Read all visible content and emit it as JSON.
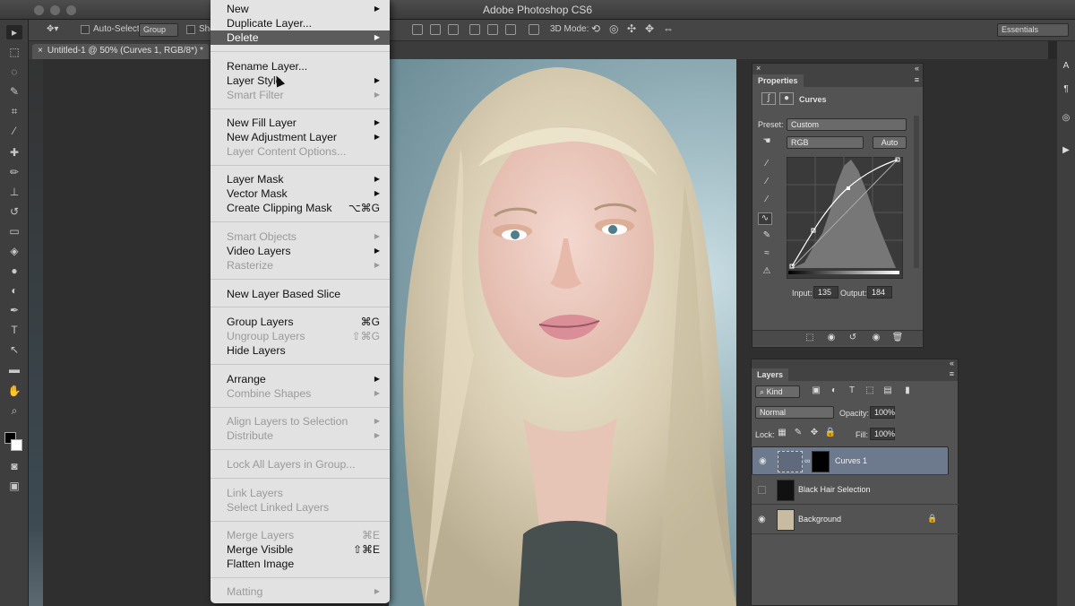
{
  "window": {
    "title": "Adobe Photoshop CS6"
  },
  "options_bar": {
    "auto_select_label": "Auto-Select:",
    "auto_select_value": "Group",
    "show_label": "Sho",
    "mode_3d_label": "3D Mode:",
    "workspace": "Essentials"
  },
  "document": {
    "tab_label": "Untitled-1 @ 50% (Curves 1, RGB/8*) *"
  },
  "menu": {
    "items": [
      {
        "label": "New",
        "submenu": "▶",
        "disabled": false
      },
      {
        "label": "Duplicate Layer...",
        "disabled": false
      },
      {
        "label": "Delete",
        "submenu": "▶",
        "highlighted": true
      },
      {
        "label": "Rename Layer...",
        "disabled": false
      },
      {
        "label": "Layer Style",
        "submenu": "▶"
      },
      {
        "label": "Smart Filter",
        "submenu": "▶",
        "disabled": true
      },
      {
        "label": "New Fill Layer",
        "submenu": "▶"
      },
      {
        "label": "New Adjustment Layer",
        "submenu": "▶"
      },
      {
        "label": "Layer Content Options...",
        "disabled": true
      },
      {
        "label": "Layer Mask",
        "submenu": "▶"
      },
      {
        "label": "Vector Mask",
        "submenu": "▶"
      },
      {
        "label": "Create Clipping Mask",
        "shortcut": "⌥⌘G"
      },
      {
        "label": "Smart Objects",
        "submenu": "▶",
        "disabled": true
      },
      {
        "label": "Video Layers",
        "submenu": "▶"
      },
      {
        "label": "Rasterize",
        "submenu": "▶",
        "disabled": true
      },
      {
        "label": "New Layer Based Slice"
      },
      {
        "label": "Group Layers",
        "shortcut": "⌘G"
      },
      {
        "label": "Ungroup Layers",
        "shortcut": "⇧⌘G",
        "disabled": true
      },
      {
        "label": "Hide Layers"
      },
      {
        "label": "Arrange",
        "submenu": "▶"
      },
      {
        "label": "Combine Shapes",
        "submenu": "▶",
        "disabled": true
      },
      {
        "label": "Align Layers to Selection",
        "submenu": "▶",
        "disabled": true
      },
      {
        "label": "Distribute",
        "submenu": "▶",
        "disabled": true
      },
      {
        "label": "Lock All Layers in Group...",
        "disabled": true
      },
      {
        "label": "Link Layers",
        "disabled": true
      },
      {
        "label": "Select Linked Layers",
        "disabled": true
      },
      {
        "label": "Merge Layers",
        "shortcut": "⌘E",
        "disabled": true
      },
      {
        "label": "Merge Visible",
        "shortcut": "⇧⌘E"
      },
      {
        "label": "Flatten Image"
      },
      {
        "label": "Matting",
        "submenu": "▶",
        "disabled": true
      }
    ]
  },
  "properties": {
    "tab": "Properties",
    "title": "Curves",
    "preset_label": "Preset:",
    "preset_value": "Custom",
    "channel": "RGB",
    "auto_button": "Auto",
    "input_label": "Input:",
    "input_value": "135",
    "output_label": "Output:",
    "output_value": "184"
  },
  "layers": {
    "tab": "Layers",
    "kind_label": "Kind",
    "blend_mode": "Normal",
    "opacity_label": "Opacity:",
    "opacity_value": "100%",
    "lock_label": "Lock:",
    "fill_label": "Fill:",
    "fill_value": "100%",
    "rows": [
      {
        "name": "Curves 1",
        "visible": true,
        "selected": true
      },
      {
        "name": "Black Hair Selection",
        "visible": false
      },
      {
        "name": "Background",
        "visible": true,
        "locked": true
      }
    ]
  },
  "colors": {
    "accent": "#6d7a8d",
    "menu_highlight": "#5b5b5b"
  }
}
